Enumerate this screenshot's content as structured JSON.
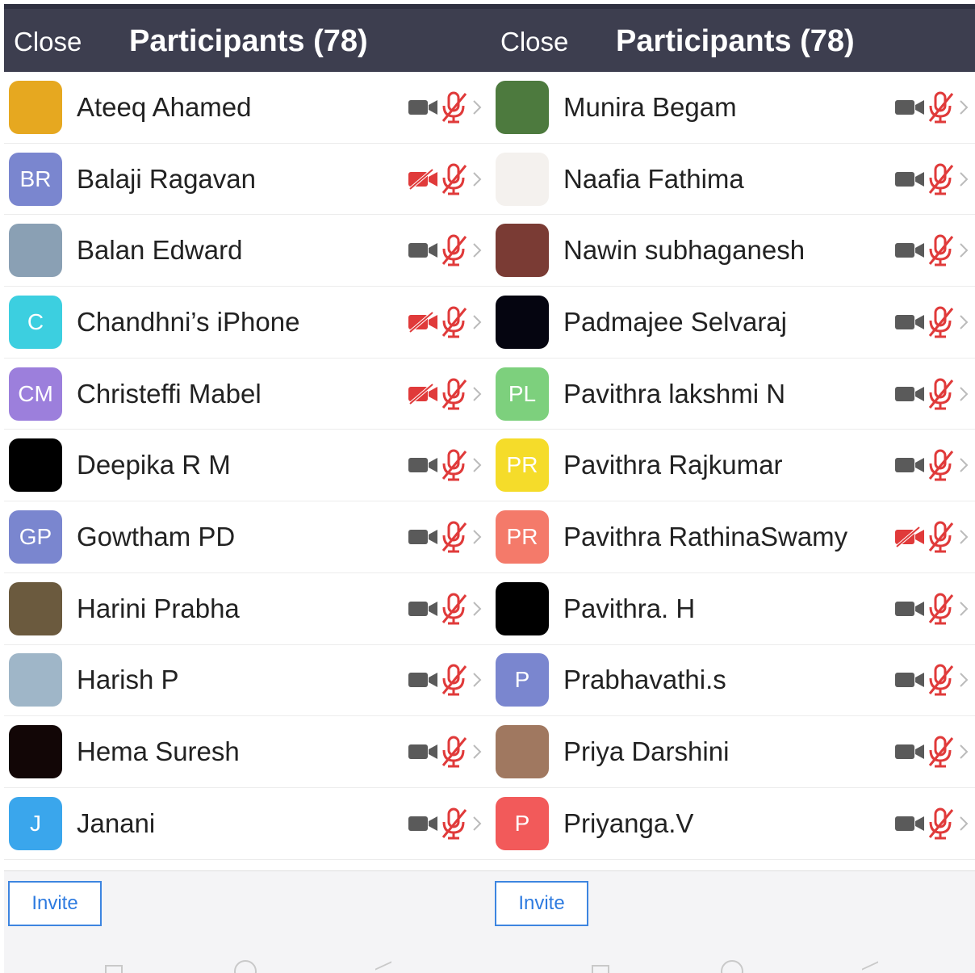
{
  "colors": {
    "header_bg": "#3d3e4f",
    "muted_red": "#e03a3a",
    "video_on_gray": "#5a5a5a",
    "accent_blue": "#2e7be0"
  },
  "panels": [
    {
      "header": {
        "close_label": "Close",
        "title": "Participants (78)"
      },
      "invite_label": "Invite",
      "participants": [
        {
          "name": "Ateeq Ahamed",
          "avatar_initials": "",
          "avatar_color": "#e6a820",
          "avatar_icon": "yellow-flowers-photo",
          "video_off": false,
          "muted": true
        },
        {
          "name": "Balaji Ragavan",
          "avatar_initials": "BR",
          "avatar_color": "#7a86cf",
          "avatar_icon": "",
          "video_off": true,
          "muted": true
        },
        {
          "name": "Balan Edward",
          "avatar_initials": "",
          "avatar_color": "#8aa0b4",
          "avatar_icon": "eagle-photo",
          "video_off": false,
          "muted": true
        },
        {
          "name": "Chandhni’s iPhone",
          "avatar_initials": "C",
          "avatar_color": "#3ccfe0",
          "avatar_icon": "",
          "video_off": true,
          "muted": true
        },
        {
          "name": "Christeffi Mabel",
          "avatar_initials": "CM",
          "avatar_color": "#9c7fdc",
          "avatar_icon": "",
          "video_off": true,
          "muted": true
        },
        {
          "name": "Deepika R M",
          "avatar_initials": "",
          "avatar_color": "#000000",
          "avatar_icon": "black-photo",
          "video_off": false,
          "muted": true
        },
        {
          "name": "Gowtham PD",
          "avatar_initials": "GP",
          "avatar_color": "#7a86cf",
          "avatar_icon": "",
          "video_off": false,
          "muted": true
        },
        {
          "name": "Harini Prabha",
          "avatar_initials": "",
          "avatar_color": "#6b5a3e",
          "avatar_icon": "sunset-photo",
          "video_off": false,
          "muted": true
        },
        {
          "name": "Harish P",
          "avatar_initials": "",
          "avatar_color": "#9fb6c8",
          "avatar_icon": "person-photo",
          "video_off": false,
          "muted": true
        },
        {
          "name": "Hema Suresh",
          "avatar_initials": "",
          "avatar_color": "#120606",
          "avatar_icon": "dark-photo",
          "video_off": false,
          "muted": true
        },
        {
          "name": "Janani",
          "avatar_initials": "J",
          "avatar_color": "#3aa6ec",
          "avatar_icon": "",
          "video_off": false,
          "muted": true
        }
      ]
    },
    {
      "header": {
        "close_label": "Close",
        "title": "Participants (78)"
      },
      "invite_label": "Invite",
      "participants": [
        {
          "name": "Munira Begam",
          "avatar_initials": "",
          "avatar_color": "#4d7a3e",
          "avatar_icon": "white-flower-photo",
          "video_off": false,
          "muted": true
        },
        {
          "name": "Naafia Fathima",
          "avatar_initials": "",
          "avatar_color": "#f4f1ee",
          "avatar_icon": "logo-photo",
          "video_off": false,
          "muted": true
        },
        {
          "name": "Nawin subhaganesh",
          "avatar_initials": "",
          "avatar_color": "#7a3b34",
          "avatar_icon": "person-photo",
          "video_off": false,
          "muted": true
        },
        {
          "name": "Padmajee Selvaraj",
          "avatar_initials": "",
          "avatar_color": "#050510",
          "avatar_icon": "black-photo",
          "video_off": false,
          "muted": true
        },
        {
          "name": "Pavithra lakshmi N",
          "avatar_initials": "PL",
          "avatar_color": "#7dd07d",
          "avatar_icon": "",
          "video_off": false,
          "muted": true
        },
        {
          "name": "Pavithra Rajkumar",
          "avatar_initials": "PR",
          "avatar_color": "#f5dc2a",
          "avatar_icon": "",
          "video_off": false,
          "muted": true
        },
        {
          "name": "Pavithra RathinaSwamy",
          "avatar_initials": "PR",
          "avatar_color": "#f47a6a",
          "avatar_icon": "",
          "video_off": true,
          "muted": true
        },
        {
          "name": "Pavithra. H",
          "avatar_initials": "",
          "avatar_color": "#000000",
          "avatar_icon": "black-photo",
          "video_off": false,
          "muted": true
        },
        {
          "name": "Prabhavathi.s",
          "avatar_initials": "P",
          "avatar_color": "#7a86cf",
          "avatar_icon": "",
          "video_off": false,
          "muted": true
        },
        {
          "name": "Priya Darshini",
          "avatar_initials": "",
          "avatar_color": "#a07860",
          "avatar_icon": "person-photo",
          "video_off": false,
          "muted": true
        },
        {
          "name": "Priyanga.V",
          "avatar_initials": "P",
          "avatar_color": "#f25a5a",
          "avatar_icon": "",
          "video_off": false,
          "muted": true
        }
      ]
    }
  ]
}
